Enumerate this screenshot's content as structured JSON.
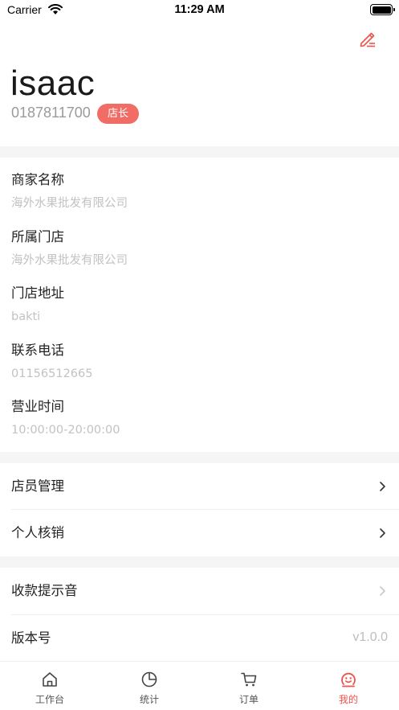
{
  "status_bar": {
    "carrier": "Carrier",
    "time": "11:29 AM"
  },
  "profile": {
    "name": "isaac",
    "phone": "0187811700",
    "role": "店长",
    "edit_icon": "edit-pencil-icon"
  },
  "info": [
    {
      "label": "商家名称",
      "value": "海外水果批发有限公司"
    },
    {
      "label": "所属门店",
      "value": "海外水果批发有限公司"
    },
    {
      "label": "门店地址",
      "value": "bakti"
    },
    {
      "label": "联系电话",
      "value": "01156512665"
    },
    {
      "label": "营业时间",
      "value": "10:00:00-20:00:00"
    }
  ],
  "menu": {
    "staff": "店员管理",
    "verify": "个人核销",
    "sound": "收款提示音",
    "version_label": "版本号",
    "version_value": "v1.0.0"
  },
  "tabs": [
    {
      "label": "工作台",
      "icon": "home-icon"
    },
    {
      "label": "统计",
      "icon": "pie-chart-icon"
    },
    {
      "label": "订单",
      "icon": "cart-icon"
    },
    {
      "label": "我的",
      "icon": "smile-user-icon"
    }
  ],
  "colors": {
    "accent": "#f0514a",
    "badge": "#f26c66",
    "muted": "#c2c2c2"
  }
}
